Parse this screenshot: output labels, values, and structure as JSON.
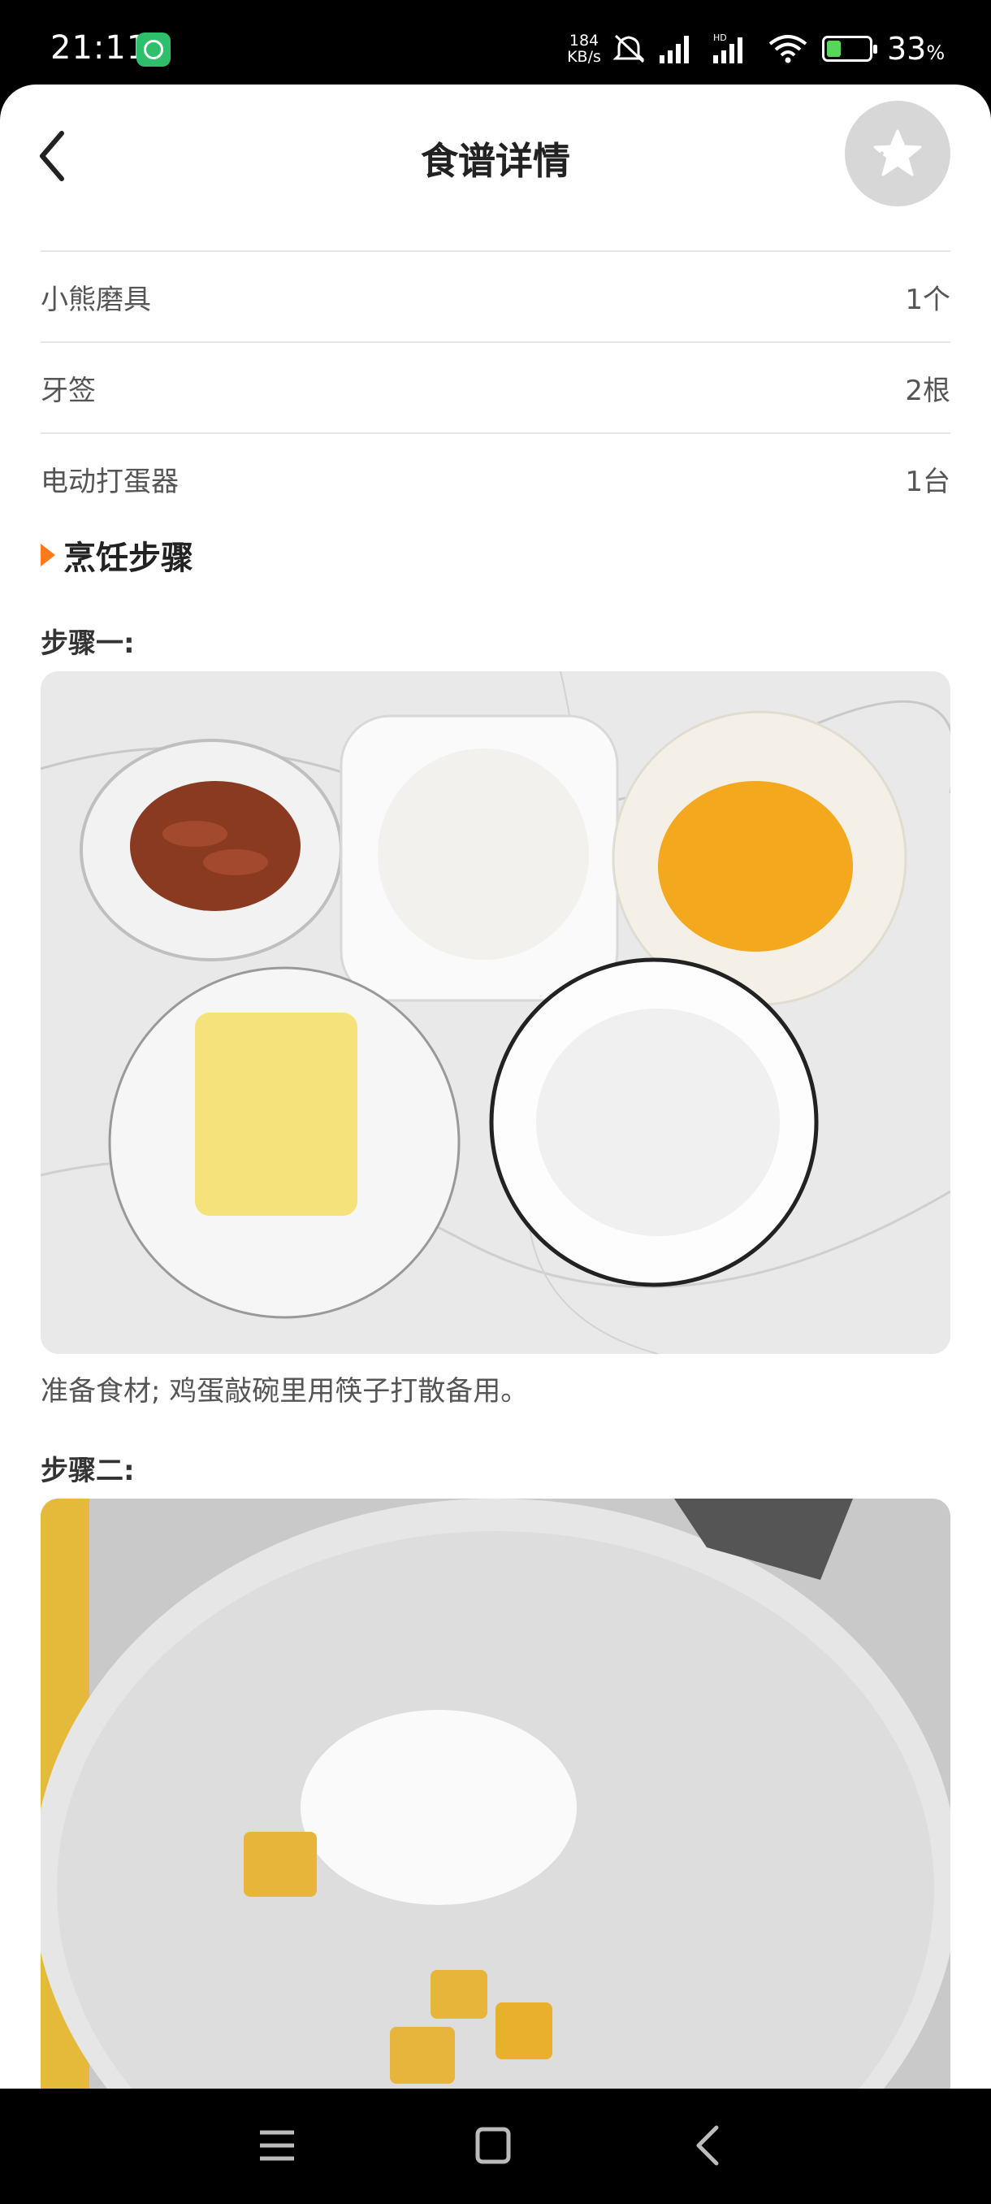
{
  "status_bar": {
    "time": "21:11",
    "net_speed_value": "184",
    "net_speed_unit": "KB/s",
    "battery_percent": "33",
    "battery_percent_unit": "%",
    "battery_level": 0.33,
    "icons": [
      "app-notification-icon",
      "mute-icon",
      "signal-icon",
      "hd-signal-icon",
      "wifi-icon",
      "battery-charging-icon"
    ]
  },
  "header": {
    "title": "食谱详情",
    "back_icon": "chevron-left-icon",
    "favorite_icon": "star-icon"
  },
  "tools": [
    {
      "name": "小熊磨具",
      "amount": "1个"
    },
    {
      "name": "牙签",
      "amount": "2根"
    },
    {
      "name": "电动打蛋器",
      "amount": "1台"
    }
  ],
  "section": {
    "title": "烹饪步骤"
  },
  "steps": [
    {
      "label": "步骤一:",
      "description": "准备食材; 鸡蛋敲碗里用筷子打散备用。"
    },
    {
      "label": "步骤二:",
      "description": ""
    }
  ],
  "navigation": {
    "icons": [
      "menu-icon",
      "home-icon",
      "back-icon"
    ]
  },
  "colors": {
    "accent": "#ff7a1a",
    "favorite_button_bg": "#d7d7d7",
    "battery_fill": "#58d65a"
  }
}
